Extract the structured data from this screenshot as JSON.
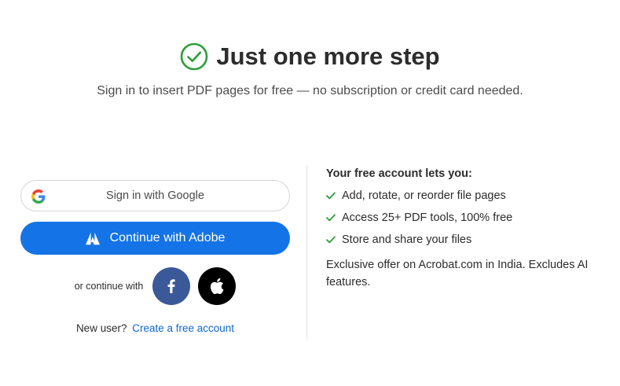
{
  "header": {
    "title": "Just one more step",
    "subtitle": "Sign in to insert PDF pages for free — no subscription or credit card needed."
  },
  "signin": {
    "google_label": "Sign in with Google",
    "adobe_label": "Continue with Adobe",
    "or_continue_with": "or continue with",
    "new_user_text": "New user?",
    "create_account_link": "Create a free account"
  },
  "benefits": {
    "title": "Your free account lets you:",
    "items": [
      {
        "label": "Add, rotate, or reorder file pages"
      },
      {
        "label": "Access 25+ PDF tools, 100% free"
      },
      {
        "label": "Store and share your files"
      }
    ],
    "offer": "Exclusive offer on Acrobat.com in India. Excludes AI features."
  },
  "colors": {
    "check_green": "#2d9d3a",
    "adobe_blue": "#1473e6",
    "facebook_blue": "#3b5998",
    "link_blue": "#0d66d0"
  },
  "icons": [
    "check-circle-icon",
    "google-icon",
    "adobe-icon",
    "facebook-icon",
    "apple-icon",
    "checkmark-icon"
  ]
}
